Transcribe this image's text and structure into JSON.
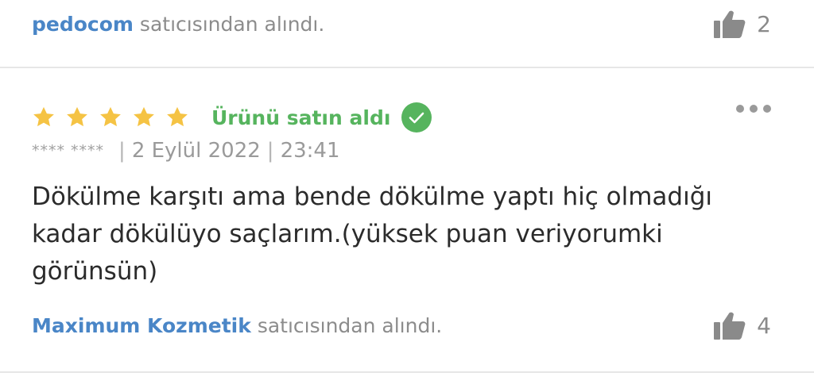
{
  "top_review": {
    "seller_name": "pedocom",
    "seller_suffix": "satıcısından alındı.",
    "like_count": "2",
    "like_icon": "thumbs-up-icon"
  },
  "review": {
    "rating": 5,
    "rating_max": 5,
    "star_color": "#f5c344",
    "purchased_label": "Ürünü satın aldı",
    "purchased_color": "#56b45e",
    "purchased_icon": "check-circle-icon",
    "more_icon": "more-dots-icon",
    "reviewer_masked": "**** ****",
    "date": "2 Eylül 2022",
    "time": "23:41",
    "separator": "|",
    "body": "Dökülme karşıtı ama bende dökülme yaptı hiç olmadığı kadar dökülüyo saçlarım.(yüksek puan veriyorumki görünsün)",
    "seller_name": "Maximum Kozmetik",
    "seller_suffix": "satıcısından alındı.",
    "like_count": "4",
    "like_icon": "thumbs-up-icon"
  },
  "colors": {
    "link_blue": "#4a86c7",
    "muted_text": "#8c8c8c",
    "divider": "#e6e6e6"
  }
}
